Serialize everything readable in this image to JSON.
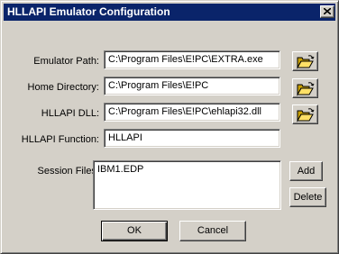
{
  "window": {
    "title": "HLLAPI Emulator Configuration"
  },
  "fields": {
    "emulator_path": {
      "label": "Emulator Path:",
      "value": "C:\\Program Files\\E!PC\\EXTRA.exe"
    },
    "home_directory": {
      "label": "Home Directory:",
      "value": "C:\\Program Files\\E!PC"
    },
    "hllapi_dll": {
      "label": "HLLAPI DLL:",
      "value": "C:\\Program Files\\E!PC\\ehlapi32.dll"
    },
    "hllapi_function": {
      "label": "HLLAPI Function:",
      "value": "HLLAPI"
    }
  },
  "session_files": {
    "label": "Session Files:",
    "items": [
      "IBM1.EDP"
    ],
    "add_label": "Add",
    "delete_label": "Delete"
  },
  "buttons": {
    "ok_label": "OK",
    "cancel_label": "Cancel"
  },
  "icons": {
    "browse": "open-folder-icon",
    "close": "close-icon"
  }
}
